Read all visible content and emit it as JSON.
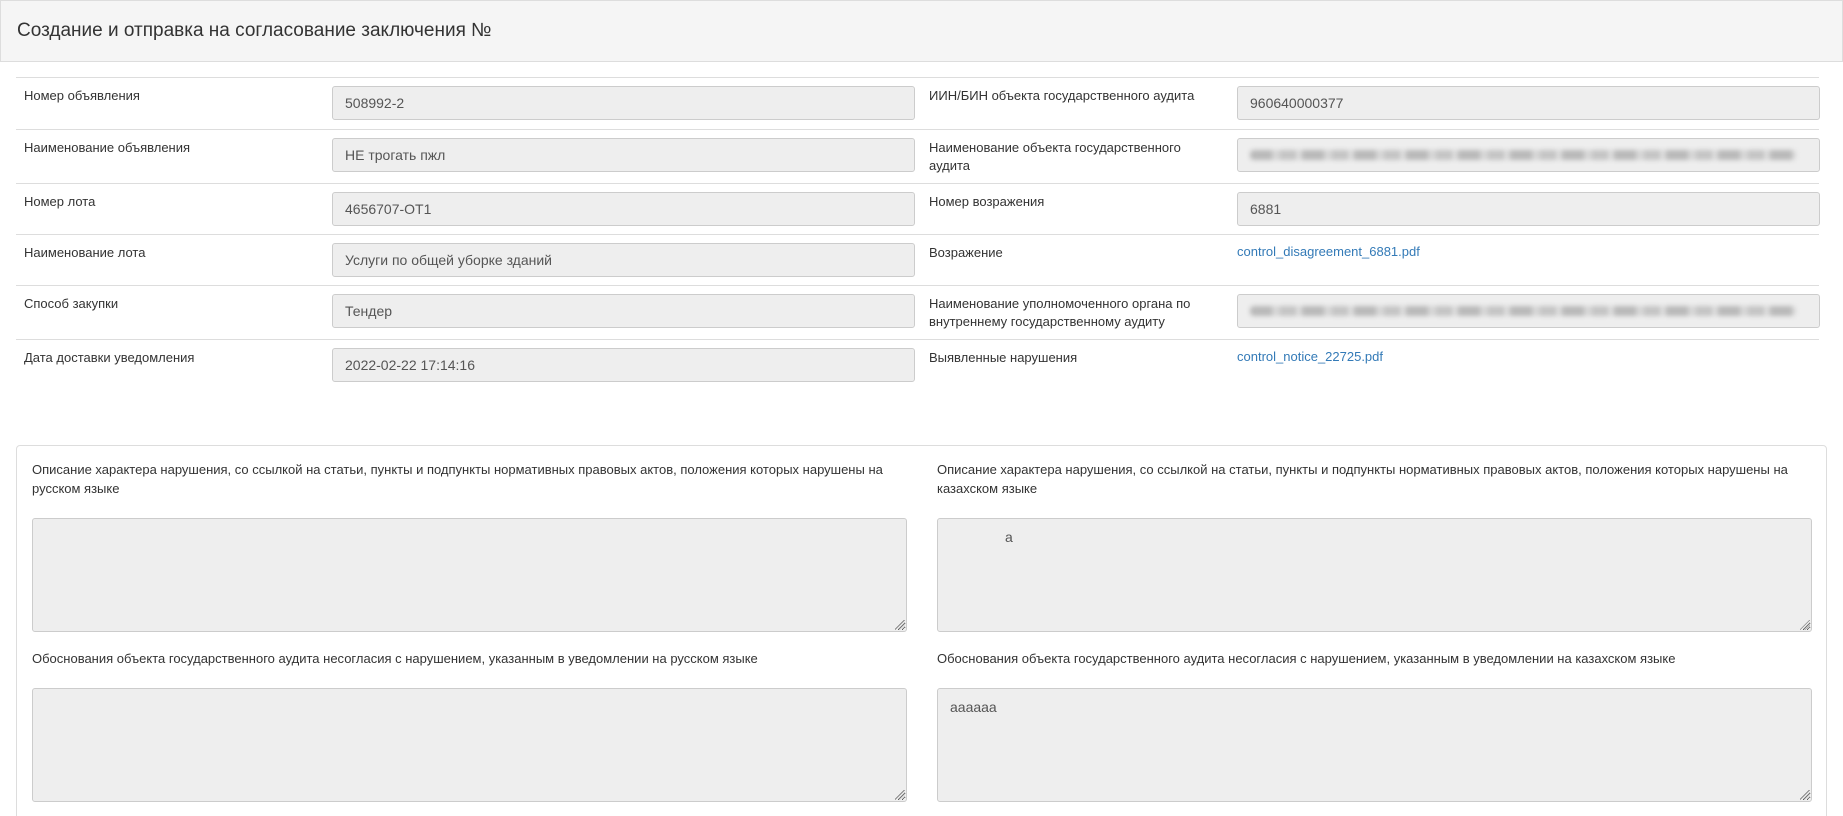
{
  "header": {
    "title": "Создание и отправка на согласование заключения №"
  },
  "info": {
    "rows": [
      {
        "left_label": "Номер объявления",
        "left_value": "508992-2",
        "right_label": "ИИН/БИН объекта государственного аудита",
        "right_value": "960640000377"
      },
      {
        "left_label": "Наименование объявления",
        "left_value": "НЕ трогать пжл",
        "right_label": "Наименование объекта государственного аудита",
        "right_value": ""
      },
      {
        "left_label": "Номер лота",
        "left_value": "4656707-ОТ1",
        "right_label": "Номер возражения",
        "right_value": "6881"
      },
      {
        "left_label": "Наименование лота",
        "left_value": "Услуги по общей уборке зданий",
        "right_label": "Возражение",
        "right_link": "control_disagreement_6881.pdf"
      },
      {
        "left_label": "Способ закупки",
        "left_value": "Тендер",
        "right_label": "Наименование уполномоченного органа по внутреннему государственному аудиту",
        "right_value": ""
      },
      {
        "left_label": "Дата доставки уведомления",
        "left_value": "2022-02-22 17:14:16",
        "right_label": "Выявленные нарушения",
        "right_link": "control_notice_22725.pdf"
      }
    ]
  },
  "descriptions": {
    "violation_ru_label": "Описание характера нарушения, со ссылкой на статьи, пункты и подпункты нормативных правовых актов, положения которых нарушены на русском языке",
    "violation_ru_value": "",
    "violation_kz_label": "Описание характера нарушения, со ссылкой на статьи, пункты и подпункты нормативных правовых актов, положения которых нарушены на казахском языке",
    "violation_kz_value": "а",
    "justification_ru_label": "Обоснования объекта государственного аудита несогласия с нарушением, указанным в уведомлении на русском языке",
    "justification_ru_value": "",
    "justification_kz_label": "Обоснования объекта государственного аудита несогласия с нарушением, указанным в уведомлении на казахском языке",
    "justification_kz_value": "аааааа"
  },
  "colors": {
    "link": "#337ab7",
    "field_bg": "#eeeeee",
    "header_bg": "#f5f5f5"
  }
}
